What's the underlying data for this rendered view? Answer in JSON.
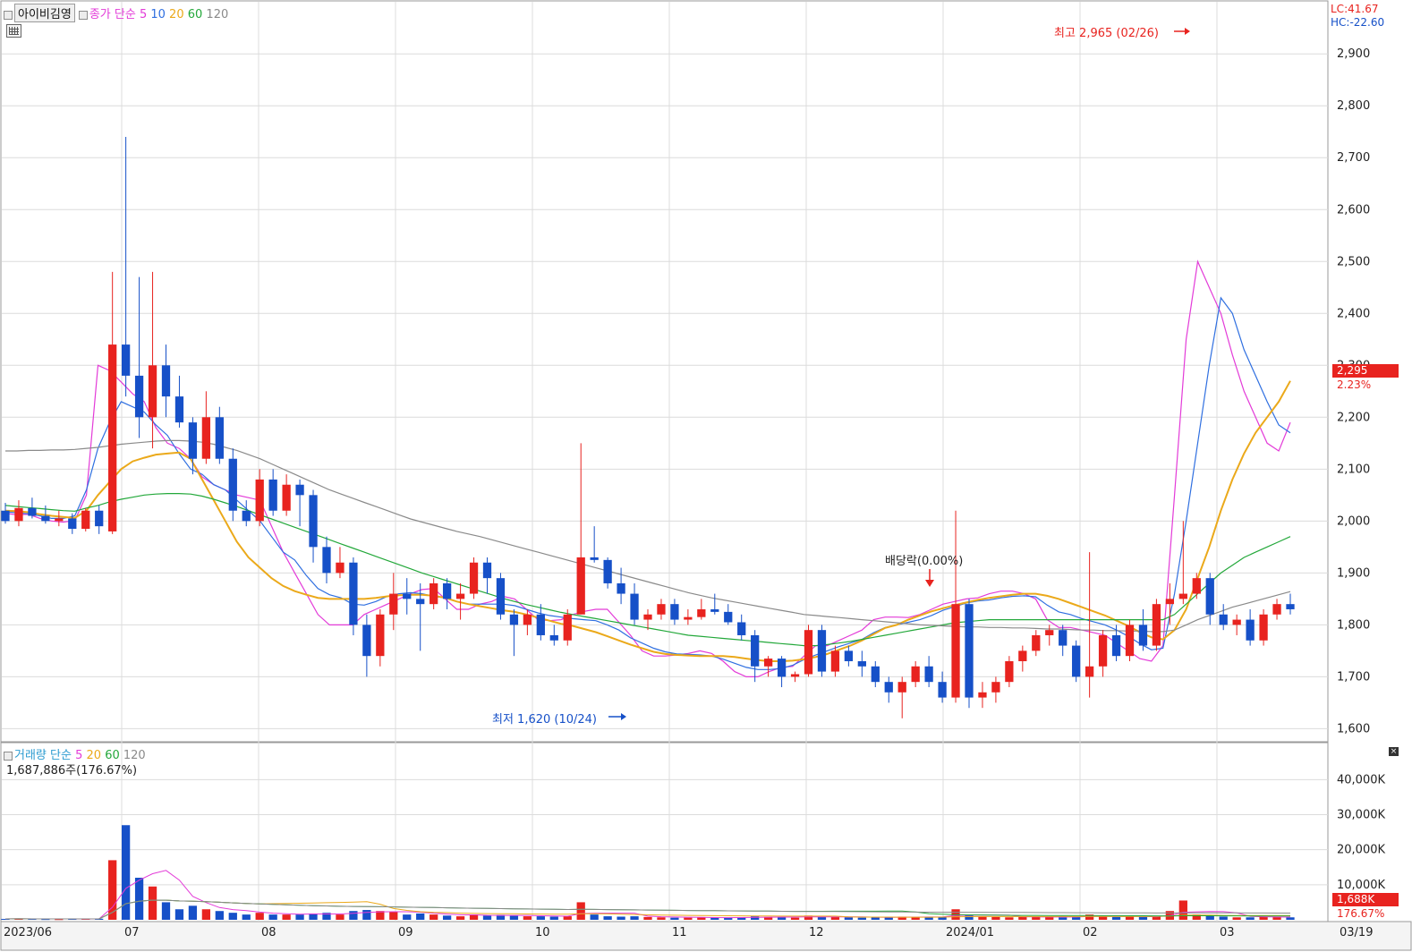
{
  "toolbar": {
    "stock_name": "아이비김영",
    "legend_prefix": "종가 단순",
    "ma_labels": [
      "5",
      "10",
      "20",
      "60",
      "120"
    ],
    "volume_prefix": "거래량 단순",
    "volume_ma_labels": [
      "5",
      "20",
      "60",
      "120"
    ],
    "volume_info": "1,687,886주(176.67%)",
    "lc": "LC:41.67",
    "hc": "HC:-22.60"
  },
  "colors": {
    "up": "#e8231f",
    "down": "#1650c8",
    "ma5": "#e33bd8",
    "ma10": "#2f6fe0",
    "ma20": "#eba91a",
    "ma60": "#23a83a",
    "ma120": "#8a8a8a",
    "grid": "#dcdcdc"
  },
  "annotations": {
    "high": "최고 2,965 (02/26)",
    "low": "최저 1,620 (10/24)",
    "dividend": "배당락(0.00%)",
    "last_price": "2,295",
    "last_change": "2.23%",
    "volume_last": "1,688K",
    "volume_pct": "176.67%"
  },
  "chart_data": {
    "type": "candlestick",
    "y_ticks": [
      "1,600",
      "1,700",
      "1,800",
      "1,900",
      "2,000",
      "2,100",
      "2,200",
      "2,300",
      "2,400",
      "2,500",
      "2,600",
      "2,700",
      "2,800",
      "2,900"
    ],
    "ylim": [
      1580,
      2990
    ],
    "volume_ticks": [
      "10,000K",
      "20,000K",
      "30,000K",
      "40,000K"
    ],
    "volume_ylim": [
      0,
      48000
    ],
    "x_labels": [
      "2023/06",
      "07",
      "08",
      "09",
      "10",
      "11",
      "12",
      "2024/01",
      "02",
      "03",
      "03/19"
    ],
    "series": [
      {
        "name": "5",
        "values": [
          2015,
          2012,
          2013,
          2005,
          2000,
          1998,
          2001,
          2050,
          2300,
          2290,
          2268,
          2245,
          2230,
          2180,
          2150,
          2140,
          2120,
          2085,
          2070,
          2060,
          2050,
          2045,
          2040,
          1990,
          1940,
          1900,
          1860,
          1820,
          1800,
          1800,
          1800,
          1820,
          1830,
          1840,
          1850,
          1860,
          1868,
          1870,
          1850,
          1830,
          1830,
          1840,
          1845,
          1855,
          1850,
          1830,
          1810,
          1808,
          1810,
          1820,
          1826,
          1830,
          1830,
          1805,
          1780,
          1750,
          1740,
          1740,
          1742,
          1745,
          1750,
          1745,
          1730,
          1710,
          1700,
          1700,
          1710,
          1718,
          1720,
          1740,
          1760,
          1760,
          1770,
          1780,
          1790,
          1810,
          1815,
          1815,
          1814,
          1820,
          1830,
          1840,
          1845,
          1850,
          1852,
          1860,
          1865,
          1865,
          1860,
          1850,
          1810,
          1795,
          1795,
          1790,
          1785,
          1780,
          1765,
          1750,
          1735,
          1730,
          1760,
          2050,
          2350,
          2500,
          2450,
          2400,
          2320,
          2250,
          2200,
          2150,
          2135,
          2190
        ]
      },
      {
        "name": "10",
        "values": [
          2018,
          2016,
          2014,
          2010,
          2005,
          2005,
          2010,
          2060,
          2140,
          2190,
          2230,
          2220,
          2210,
          2185,
          2165,
          2130,
          2100,
          2090,
          2070,
          2060,
          2040,
          2020,
          2000,
          1970,
          1940,
          1925,
          1895,
          1870,
          1858,
          1852,
          1840,
          1838,
          1845,
          1855,
          1860,
          1862,
          1860,
          1855,
          1852,
          1845,
          1840,
          1840,
          1840,
          1840,
          1837,
          1830,
          1823,
          1818,
          1815,
          1812,
          1810,
          1808,
          1800,
          1790,
          1775,
          1765,
          1755,
          1748,
          1744,
          1743,
          1742,
          1740,
          1734,
          1726,
          1718,
          1714,
          1714,
          1716,
          1722,
          1733,
          1742,
          1750,
          1758,
          1765,
          1772,
          1785,
          1795,
          1800,
          1805,
          1810,
          1818,
          1828,
          1835,
          1842,
          1846,
          1848,
          1852,
          1855,
          1856,
          1854,
          1838,
          1825,
          1820,
          1812,
          1806,
          1800,
          1790,
          1778,
          1764,
          1752,
          1755,
          1860,
          2000,
          2150,
          2300,
          2430,
          2400,
          2330,
          2280,
          2230,
          2185,
          2170
        ]
      },
      {
        "name": "20",
        "values": [
          2020,
          2019,
          2017,
          2013,
          2010,
          2008,
          2006,
          2020,
          2050,
          2075,
          2100,
          2115,
          2122,
          2128,
          2130,
          2132,
          2120,
          2080,
          2040,
          2000,
          1960,
          1930,
          1910,
          1890,
          1875,
          1865,
          1858,
          1852,
          1850,
          1850,
          1850,
          1850,
          1852,
          1855,
          1857,
          1858,
          1858,
          1856,
          1852,
          1845,
          1840,
          1836,
          1832,
          1828,
          1825,
          1820,
          1814,
          1808,
          1802,
          1798,
          1792,
          1786,
          1778,
          1770,
          1762,
          1755,
          1748,
          1744,
          1742,
          1741,
          1740,
          1740,
          1740,
          1738,
          1735,
          1732,
          1730,
          1730,
          1731,
          1734,
          1738,
          1744,
          1752,
          1760,
          1770,
          1782,
          1794,
          1800,
          1810,
          1818,
          1826,
          1832,
          1838,
          1843,
          1848,
          1852,
          1855,
          1858,
          1860,
          1860,
          1856,
          1850,
          1842,
          1834,
          1826,
          1818,
          1808,
          1798,
          1786,
          1776,
          1772,
          1790,
          1830,
          1890,
          1950,
          2020,
          2080,
          2130,
          2170,
          2200,
          2230,
          2270
        ]
      },
      {
        "name": "60",
        "values": [
          2030,
          2028,
          2026,
          2024,
          2022,
          2020,
          2019,
          2025,
          2030,
          2037,
          2042,
          2046,
          2050,
          2052,
          2053,
          2053,
          2052,
          2048,
          2042,
          2035,
          2028,
          2020,
          2012,
          2004,
          1996,
          1988,
          1980,
          1972,
          1964,
          1956,
          1948,
          1940,
          1932,
          1924,
          1916,
          1908,
          1900,
          1893,
          1886,
          1879,
          1872,
          1865,
          1858,
          1851,
          1845,
          1839,
          1834,
          1829,
          1824,
          1820,
          1816,
          1812,
          1808,
          1804,
          1800,
          1796,
          1792,
          1788,
          1784,
          1780,
          1778,
          1776,
          1774,
          1772,
          1770,
          1768,
          1766,
          1764,
          1762,
          1760,
          1760,
          1762,
          1765,
          1768,
          1772,
          1776,
          1780,
          1784,
          1788,
          1792,
          1796,
          1800,
          1804,
          1806,
          1808,
          1810,
          1810,
          1810,
          1810,
          1810,
          1810,
          1810,
          1810,
          1810,
          1810,
          1810,
          1810,
          1810,
          1810,
          1810,
          1810,
          1820,
          1840,
          1860,
          1880,
          1900,
          1915,
          1930,
          1940,
          1950,
          1960,
          1970
        ]
      },
      {
        "name": "120",
        "values": [
          2135,
          2135,
          2136,
          2136,
          2137,
          2137,
          2138,
          2140,
          2142,
          2145,
          2148,
          2150,
          2152,
          2154,
          2155,
          2155,
          2154,
          2152,
          2148,
          2142,
          2136,
          2128,
          2120,
          2110,
          2100,
          2090,
          2080,
          2070,
          2060,
          2052,
          2044,
          2036,
          2028,
          2020,
          2012,
          2004,
          1998,
          1992,
          1986,
          1980,
          1975,
          1970,
          1964,
          1958,
          1952,
          1946,
          1940,
          1934,
          1928,
          1922,
          1916,
          1910,
          1904,
          1898,
          1892,
          1886,
          1880,
          1874,
          1868,
          1862,
          1857,
          1852,
          1848,
          1844,
          1840,
          1836,
          1832,
          1828,
          1824,
          1820,
          1818,
          1816,
          1814,
          1812,
          1810,
          1808,
          1806,
          1804,
          1802,
          1800,
          1799,
          1798,
          1797,
          1796,
          1796,
          1795,
          1795,
          1794,
          1794,
          1793,
          1792,
          1792,
          1791,
          1790,
          1790,
          1789,
          1789,
          1788,
          1788,
          1787,
          1787,
          1790,
          1800,
          1810,
          1818,
          1826,
          1834,
          1840,
          1846,
          1852,
          1858,
          1864
        ]
      }
    ],
    "candles": [
      [
        2020,
        2035,
        1995,
        2000,
        250
      ],
      [
        2000,
        2040,
        1990,
        2025,
        300
      ],
      [
        2025,
        2045,
        2005,
        2010,
        250
      ],
      [
        2010,
        2030,
        1995,
        2000,
        220
      ],
      [
        2000,
        2020,
        1990,
        2005,
        200
      ],
      [
        2005,
        2015,
        1975,
        1985,
        250
      ],
      [
        1985,
        2025,
        1980,
        2020,
        280
      ],
      [
        2020,
        2030,
        1975,
        1990,
        300
      ],
      [
        1980,
        2480,
        1975,
        2340,
        17000
      ],
      [
        2340,
        2740,
        2240,
        2280,
        27000
      ],
      [
        2280,
        2470,
        2160,
        2200,
        12000
      ],
      [
        2200,
        2480,
        2140,
        2300,
        9500
      ],
      [
        2300,
        2340,
        2200,
        2240,
        5000
      ],
      [
        2240,
        2280,
        2180,
        2190,
        3000
      ],
      [
        2190,
        2200,
        2090,
        2120,
        4000
      ],
      [
        2120,
        2250,
        2110,
        2200,
        3000
      ],
      [
        2200,
        2220,
        2110,
        2120,
        2500
      ],
      [
        2120,
        2140,
        2000,
        2020,
        2000
      ],
      [
        2020,
        2040,
        1990,
        2000,
        1500
      ],
      [
        2000,
        2100,
        1990,
        2080,
        2000
      ],
      [
        2080,
        2100,
        2010,
        2020,
        1500
      ],
      [
        2020,
        2090,
        2010,
        2070,
        1500
      ],
      [
        2070,
        2080,
        1990,
        2050,
        1500
      ],
      [
        2050,
        2060,
        1920,
        1950,
        1800
      ],
      [
        1950,
        1970,
        1880,
        1900,
        2000
      ],
      [
        1900,
        1950,
        1890,
        1920,
        1500
      ],
      [
        1920,
        1930,
        1780,
        1800,
        2500
      ],
      [
        1800,
        1820,
        1700,
        1740,
        2800
      ],
      [
        1740,
        1830,
        1720,
        1820,
        2500
      ],
      [
        1820,
        1900,
        1790,
        1860,
        2200
      ],
      [
        1860,
        1890,
        1820,
        1850,
        1500
      ],
      [
        1850,
        1880,
        1750,
        1840,
        1800
      ],
      [
        1840,
        1890,
        1830,
        1880,
        1500
      ],
      [
        1880,
        1890,
        1830,
        1850,
        1200
      ],
      [
        1850,
        1880,
        1810,
        1860,
        1000
      ],
      [
        1860,
        1930,
        1850,
        1920,
        1500
      ],
      [
        1920,
        1930,
        1860,
        1890,
        1200
      ],
      [
        1890,
        1900,
        1810,
        1820,
        1400
      ],
      [
        1820,
        1830,
        1740,
        1800,
        1200
      ],
      [
        1800,
        1830,
        1780,
        1820,
        1000
      ],
      [
        1820,
        1840,
        1770,
        1780,
        1000
      ],
      [
        1780,
        1800,
        1760,
        1770,
        900
      ],
      [
        1770,
        1830,
        1760,
        1820,
        1000
      ],
      [
        1820,
        2150,
        1820,
        1930,
        5000
      ],
      [
        1930,
        1990,
        1920,
        1925,
        1500
      ],
      [
        1925,
        1930,
        1870,
        1880,
        1000
      ],
      [
        1880,
        1910,
        1840,
        1860,
        900
      ],
      [
        1860,
        1880,
        1800,
        1810,
        1000
      ],
      [
        1810,
        1830,
        1790,
        1820,
        800
      ],
      [
        1820,
        1850,
        1810,
        1840,
        700
      ],
      [
        1840,
        1850,
        1800,
        1810,
        600
      ],
      [
        1810,
        1830,
        1800,
        1815,
        600
      ],
      [
        1815,
        1850,
        1810,
        1830,
        700
      ],
      [
        1830,
        1860,
        1820,
        1825,
        600
      ],
      [
        1825,
        1840,
        1800,
        1805,
        600
      ],
      [
        1805,
        1820,
        1770,
        1780,
        700
      ],
      [
        1780,
        1790,
        1690,
        1720,
        1000
      ],
      [
        1720,
        1740,
        1700,
        1735,
        800
      ],
      [
        1735,
        1740,
        1680,
        1700,
        700
      ],
      [
        1700,
        1710,
        1690,
        1705,
        600
      ],
      [
        1705,
        1800,
        1700,
        1790,
        1200
      ],
      [
        1790,
        1800,
        1700,
        1710,
        900
      ],
      [
        1710,
        1760,
        1700,
        1750,
        800
      ],
      [
        1750,
        1760,
        1720,
        1730,
        700
      ],
      [
        1730,
        1750,
        1700,
        1720,
        600
      ],
      [
        1720,
        1730,
        1680,
        1690,
        700
      ],
      [
        1690,
        1700,
        1650,
        1670,
        800
      ],
      [
        1670,
        1700,
        1620,
        1690,
        900
      ],
      [
        1690,
        1730,
        1680,
        1720,
        800
      ],
      [
        1720,
        1740,
        1680,
        1690,
        700
      ],
      [
        1690,
        1710,
        1650,
        1660,
        800
      ],
      [
        1660,
        2020,
        1650,
        1840,
        3000
      ],
      [
        1840,
        1850,
        1640,
        1660,
        1200
      ],
      [
        1660,
        1690,
        1640,
        1670,
        900
      ],
      [
        1670,
        1700,
        1650,
        1690,
        800
      ],
      [
        1690,
        1740,
        1680,
        1730,
        700
      ],
      [
        1730,
        1760,
        1710,
        1750,
        800
      ],
      [
        1750,
        1790,
        1740,
        1780,
        900
      ],
      [
        1780,
        1800,
        1760,
        1790,
        800
      ],
      [
        1790,
        1800,
        1740,
        1760,
        700
      ],
      [
        1760,
        1770,
        1690,
        1700,
        800
      ],
      [
        1700,
        1940,
        1660,
        1720,
        1500
      ],
      [
        1720,
        1790,
        1700,
        1780,
        900
      ],
      [
        1780,
        1800,
        1730,
        1740,
        800
      ],
      [
        1740,
        1810,
        1730,
        1800,
        900
      ],
      [
        1800,
        1830,
        1750,
        1760,
        800
      ],
      [
        1760,
        1850,
        1750,
        1840,
        1000
      ],
      [
        1840,
        1880,
        1800,
        1850,
        2500
      ],
      [
        1850,
        2000,
        1840,
        1860,
        5500
      ],
      [
        1860,
        1900,
        1850,
        1890,
        1500
      ],
      [
        1890,
        1900,
        1800,
        1820,
        1200
      ],
      [
        1820,
        1840,
        1790,
        1800,
        900
      ],
      [
        1800,
        1820,
        1780,
        1810,
        700
      ],
      [
        1810,
        1830,
        1760,
        1770,
        700
      ],
      [
        1770,
        1830,
        1760,
        1820,
        800
      ],
      [
        1820,
        1850,
        1810,
        1840,
        900
      ],
      [
        1840,
        1860,
        1820,
        1830,
        700
      ]
    ]
  }
}
